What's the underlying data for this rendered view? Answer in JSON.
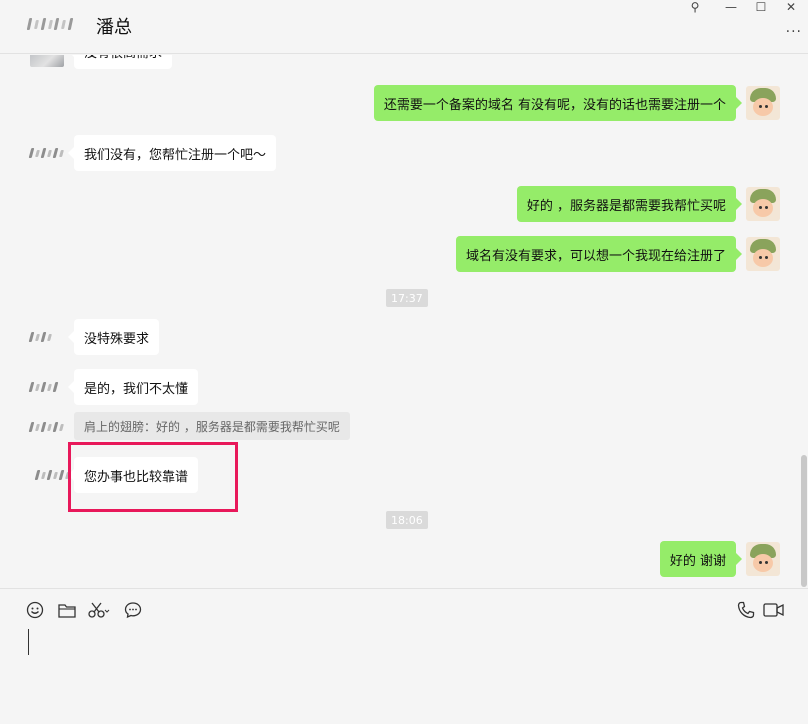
{
  "header": {
    "contact_name": "潘总",
    "window_controls": {
      "pin": "⚲",
      "minimize": "—",
      "maximize": "☐",
      "close": "✕"
    },
    "more_label": "···"
  },
  "chat": {
    "partial_message": "没有很高需求",
    "messages": [
      {
        "from": "me",
        "text": "还需要一个备案的域名 有没有呢，没有的话也需要注册一个"
      },
      {
        "from": "them",
        "text": "我们没有，您帮忙注册一个吧～"
      },
      {
        "from": "me",
        "text": "好的 ，服务器是都需要我帮忙买呢"
      },
      {
        "from": "me",
        "text": "域名有没有要求，可以想一个我现在给注册了"
      },
      {
        "from": "time",
        "text": "17:37"
      },
      {
        "from": "them",
        "text": "没特殊要求"
      },
      {
        "from": "them",
        "text": "是的，我们不太懂"
      },
      {
        "from": "quote",
        "text": "肩上的翅膀：好的 ，服务器是都需要我帮忙买呢"
      },
      {
        "from": "them",
        "text": "您办事也比较靠谱"
      },
      {
        "from": "time",
        "text": "18:06"
      },
      {
        "from": "me",
        "text": "好的 谢谢"
      }
    ]
  },
  "input": {
    "value": ""
  },
  "colors": {
    "outgoing_bubble": "#95ec69",
    "incoming_bubble": "#ffffff",
    "highlight": "#e8185a",
    "background": "#f5f5f5"
  },
  "icons": [
    "emoji-icon",
    "folder-icon",
    "scissors-icon",
    "chat-history-icon",
    "phone-icon",
    "video-call-icon"
  ]
}
